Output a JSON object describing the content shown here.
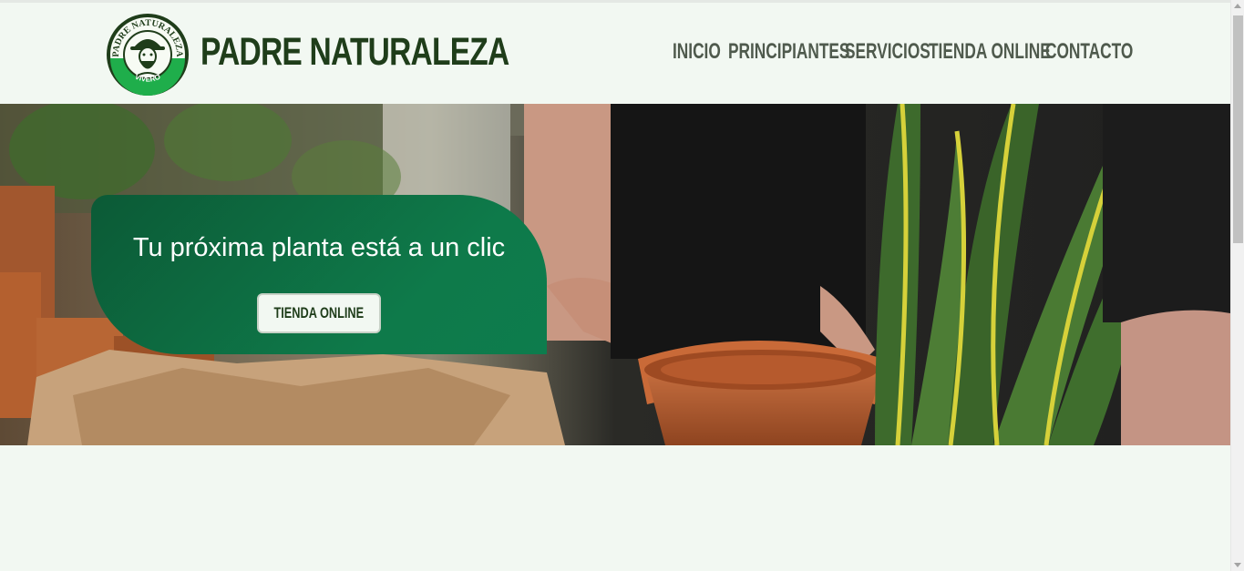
{
  "brand": {
    "name": "PADRE NATURALEZA",
    "logo_top_text": "PADRE NATURALEZA",
    "logo_bottom_text": "VIVERO"
  },
  "nav": {
    "items": [
      {
        "label": "INICIO"
      },
      {
        "label": "PRINCIPIANTES"
      },
      {
        "label": "SERVICIOS"
      },
      {
        "label": "TIENDA ONLINE"
      },
      {
        "label": "CONTACTO"
      }
    ]
  },
  "hero": {
    "title": "Tu próxima planta está a un clic",
    "button_label": "TIENDA ONLINE"
  },
  "colors": {
    "background": "#f2f8f2",
    "brand_dark_green": "#1f3d1a",
    "card_green": "#0e7a4a",
    "nav_text": "#4f5a4d",
    "logo_green": "#1fae4b"
  }
}
